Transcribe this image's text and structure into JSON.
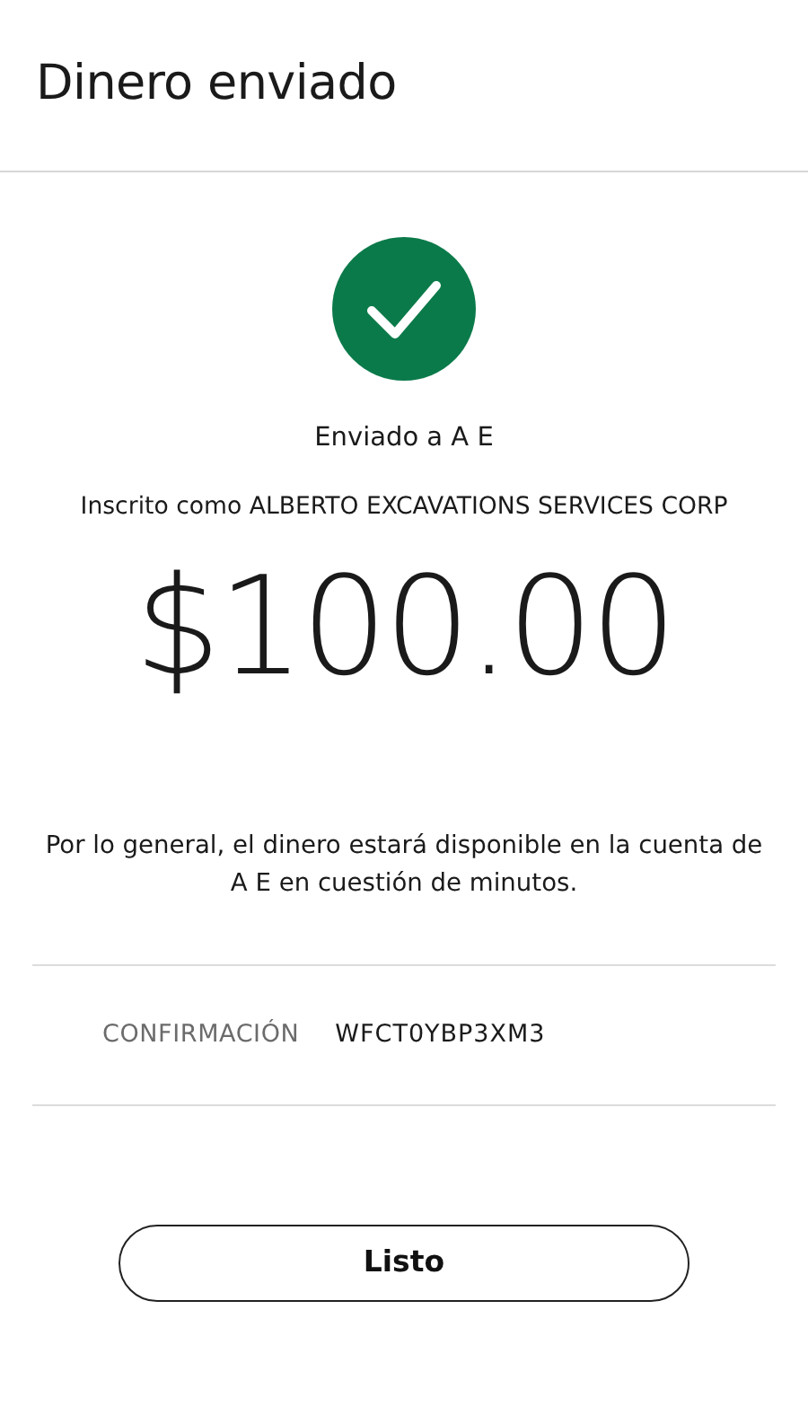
{
  "header": {
    "title": "Dinero enviado"
  },
  "recipient": "Enviado a A E",
  "registered_as": "Inscrito como ALBERTO EXCAVATIONS SERVICES CORP",
  "amount": "$100.00",
  "note": "Por lo general, el dinero estará disponible en la cuenta de A E en cuestión de minutos.",
  "confirmation": {
    "label": "CONFIRMACIÓN",
    "value": "WFCT0YBP3XM3"
  },
  "button": "Listo"
}
